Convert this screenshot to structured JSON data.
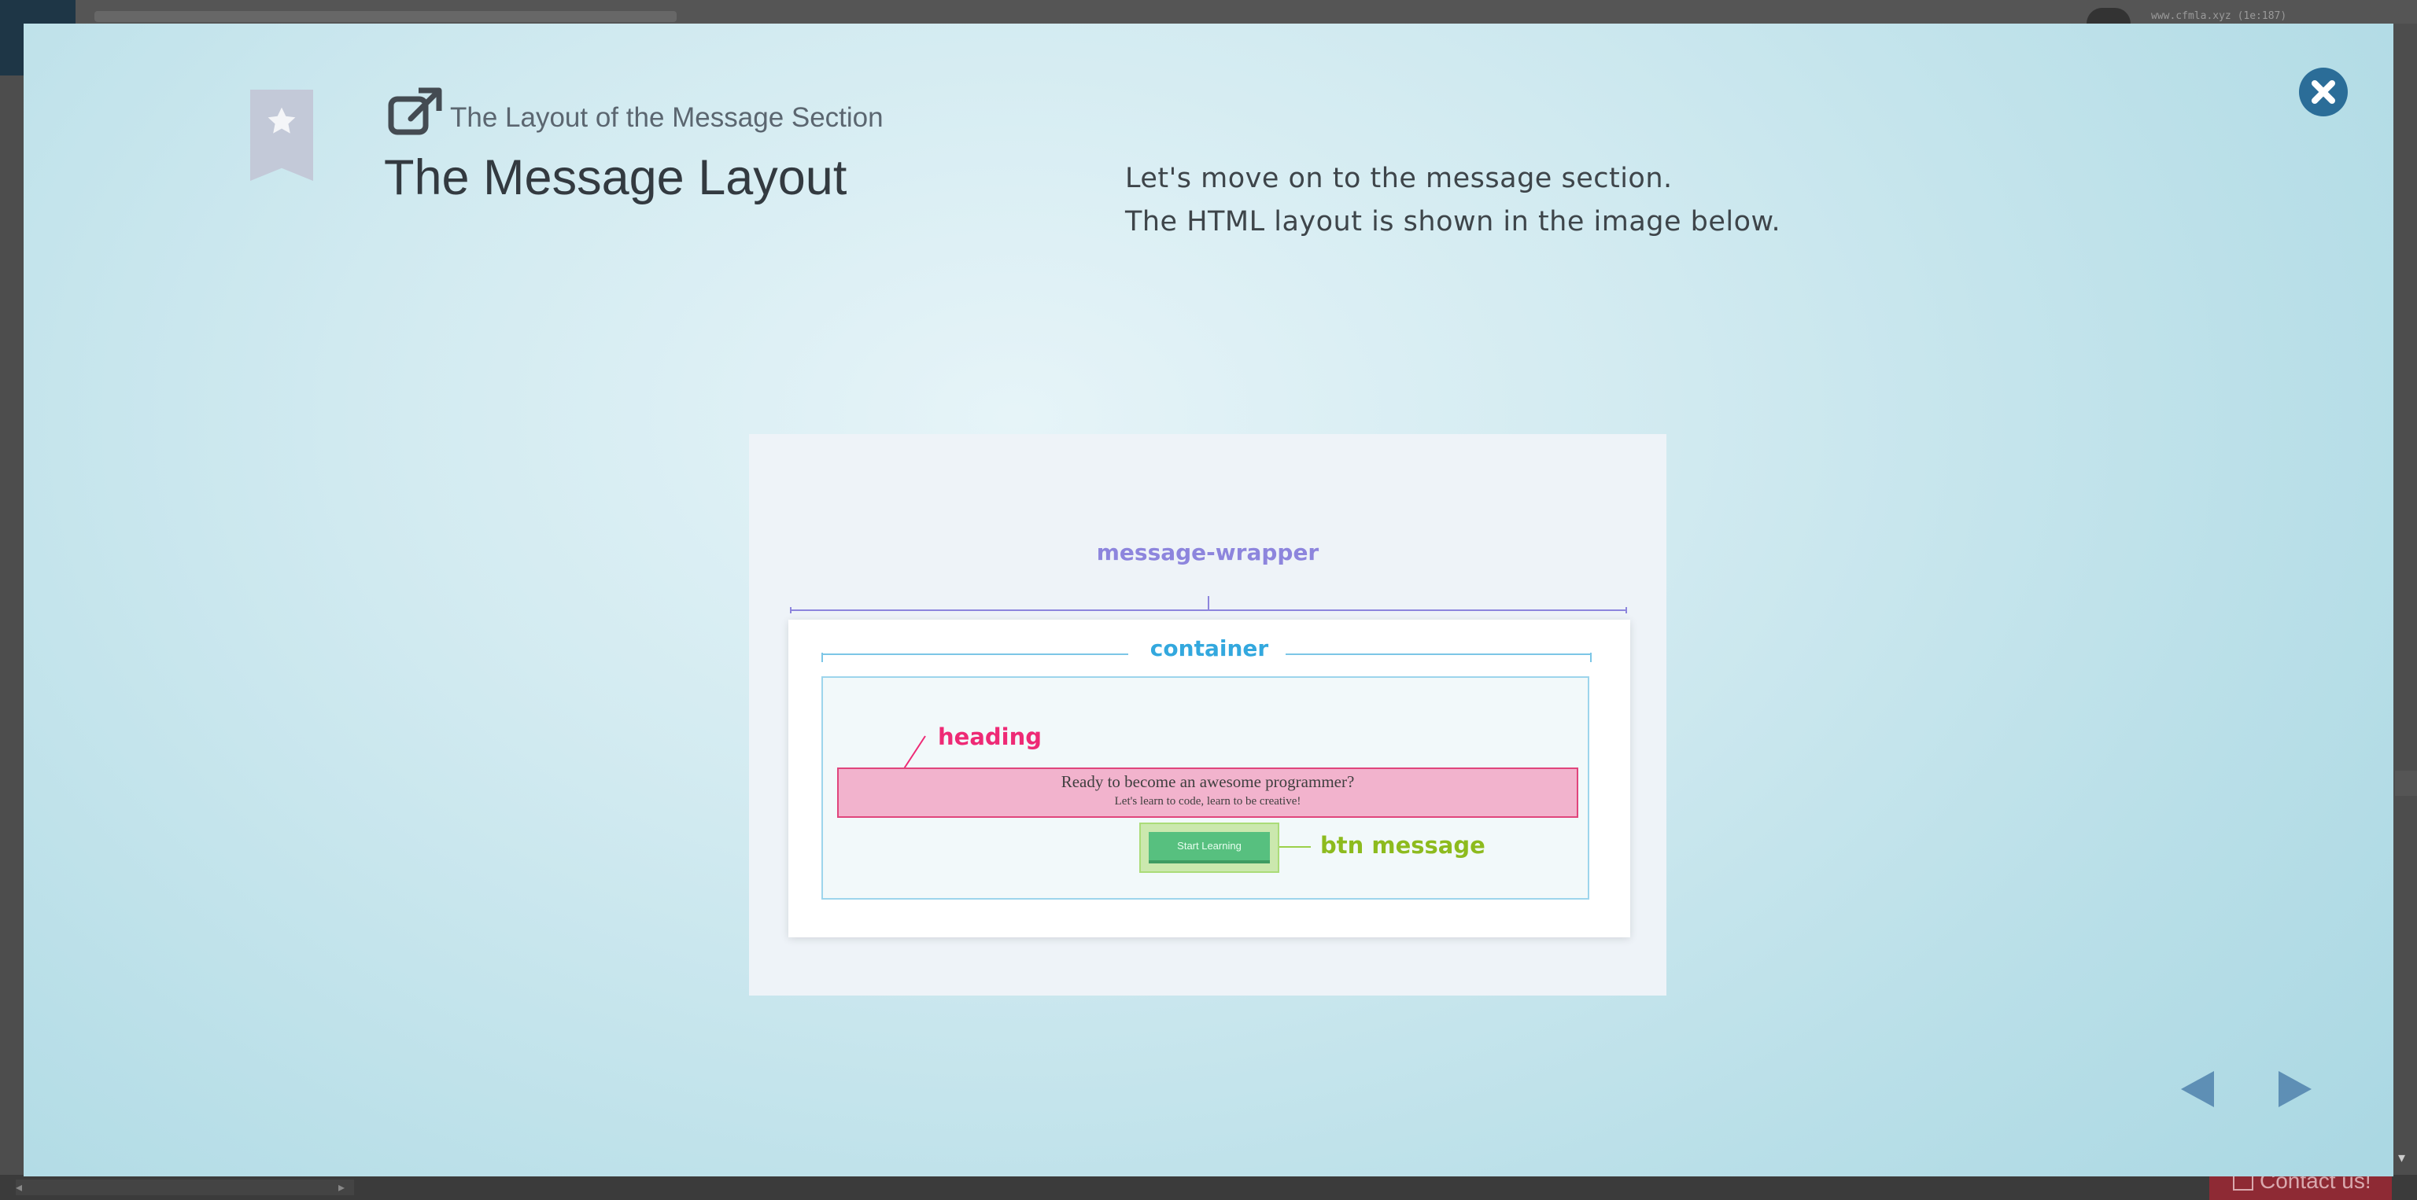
{
  "background": {
    "url_text": "www.cfmla.xyz (1e:187)",
    "contact_label": "Contact us!"
  },
  "modal": {
    "section_subtitle": "The Layout of the Message Section",
    "title": "The Message Layout",
    "description": [
      "Let's move on to the message section.",
      "The HTML layout is shown in the image below."
    ]
  },
  "diagram": {
    "wrapper_label": "message-wrapper",
    "container_label": "container",
    "heading_label": "heading",
    "heading_text": "Ready to become an awesome programmer?",
    "heading_subtext": "Let's learn to code, learn to be creative!",
    "button_text": "Start Learning",
    "button_label": "btn message"
  },
  "colors": {
    "wrapper": "#8d85dd",
    "container": "#33a8de",
    "heading": "#ee2a75",
    "button_label": "#8dbb1e",
    "accent": "#2b6d98"
  },
  "icons": {
    "bookmark": "star-ribbon-icon",
    "external": "external-link-icon",
    "close": "close-icon",
    "prev": "triangle-left-icon",
    "next": "triangle-right-icon"
  }
}
